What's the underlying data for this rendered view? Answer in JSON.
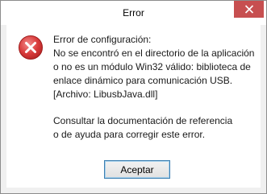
{
  "window": {
    "title": "Error"
  },
  "dialog": {
    "message_lines": [
      "Error de configuración:",
      "No se encontró en el directorio de la aplicación",
      "o no es un módulo Win32 válido: biblioteca de",
      "enlace dinámico para comunicación USB.",
      "[Archivo: LibusbJava.dll]"
    ],
    "advice_lines": [
      "Consultar la documentación de referencia",
      "o de ayuda para corregir este error."
    ],
    "ok_label": "Aceptar"
  },
  "icons": {
    "error": "error-icon",
    "close": "close-icon"
  },
  "colors": {
    "close_button": "#c74f50",
    "error_icon": "#d83b3b",
    "button_border": "#3c7fb1"
  }
}
